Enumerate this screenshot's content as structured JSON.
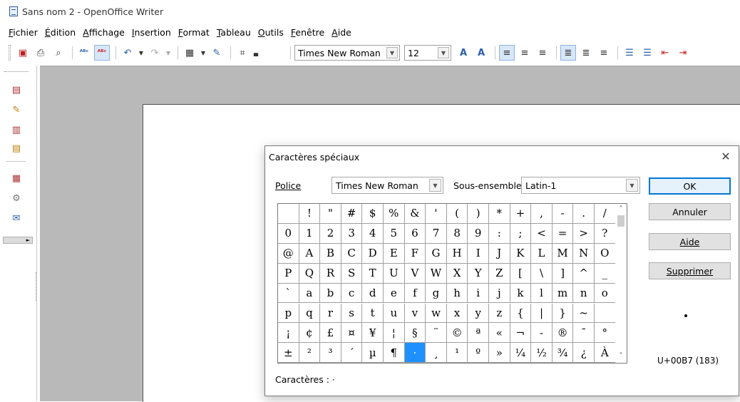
{
  "window": {
    "title": "Sans nom 2 - OpenOffice Writer"
  },
  "menu": [
    {
      "label": "Fichier"
    },
    {
      "label": "Édition"
    },
    {
      "label": "Affichage"
    },
    {
      "label": "Insertion"
    },
    {
      "label": "Format"
    },
    {
      "label": "Tableau"
    },
    {
      "label": "Outils"
    },
    {
      "label": "Fenêtre"
    },
    {
      "label": "Aide"
    }
  ],
  "toolbar": {
    "font_name": "Times New Roman",
    "font_size": "12"
  },
  "dialog": {
    "title": "Caractères spéciaux",
    "font_label": "Police",
    "font_value": "Times New Roman",
    "subset_label": "Sous-ensemble",
    "subset_value": "Latin-1",
    "buttons": {
      "ok": "OK",
      "cancel": "Annuler",
      "help": "Aide",
      "delete": "Supprimer"
    },
    "preview_char": "·",
    "codepoint": "U+00B7 (183)",
    "characters_label": "Caractères :",
    "characters_value": "·",
    "grid_rows": [
      [
        "",
        "!",
        "\"",
        "#",
        "$",
        "%",
        "&",
        "'",
        "(",
        ")",
        "*",
        "+",
        ",",
        "-",
        ".",
        "/"
      ],
      [
        "0",
        "1",
        "2",
        "3",
        "4",
        "5",
        "6",
        "7",
        "8",
        "9",
        ":",
        ";",
        "<",
        "=",
        ">",
        "?"
      ],
      [
        "@",
        "A",
        "B",
        "C",
        "D",
        "E",
        "F",
        "G",
        "H",
        "I",
        "J",
        "K",
        "L",
        "M",
        "N",
        "O"
      ],
      [
        "P",
        "Q",
        "R",
        "S",
        "T",
        "U",
        "V",
        "W",
        "X",
        "Y",
        "Z",
        "[",
        "\\",
        "]",
        "^",
        "_"
      ],
      [
        "`",
        "a",
        "b",
        "c",
        "d",
        "e",
        "f",
        "g",
        "h",
        "i",
        "j",
        "k",
        "l",
        "m",
        "n",
        "o"
      ],
      [
        "p",
        "q",
        "r",
        "s",
        "t",
        "u",
        "v",
        "w",
        "x",
        "y",
        "z",
        "{",
        "|",
        "}",
        "~",
        ""
      ],
      [
        "¡",
        "¢",
        "£",
        "¤",
        "¥",
        "¦",
        "§",
        "¨",
        "©",
        "ª",
        "«",
        "¬",
        "-",
        "®",
        "¯",
        "°"
      ],
      [
        "±",
        "²",
        "³",
        "´",
        "µ",
        "¶",
        "·",
        "¸",
        "¹",
        "º",
        "»",
        "¼",
        "½",
        "¾",
        "¿",
        "À"
      ]
    ],
    "selected_row": 7,
    "selected_col": 6
  }
}
